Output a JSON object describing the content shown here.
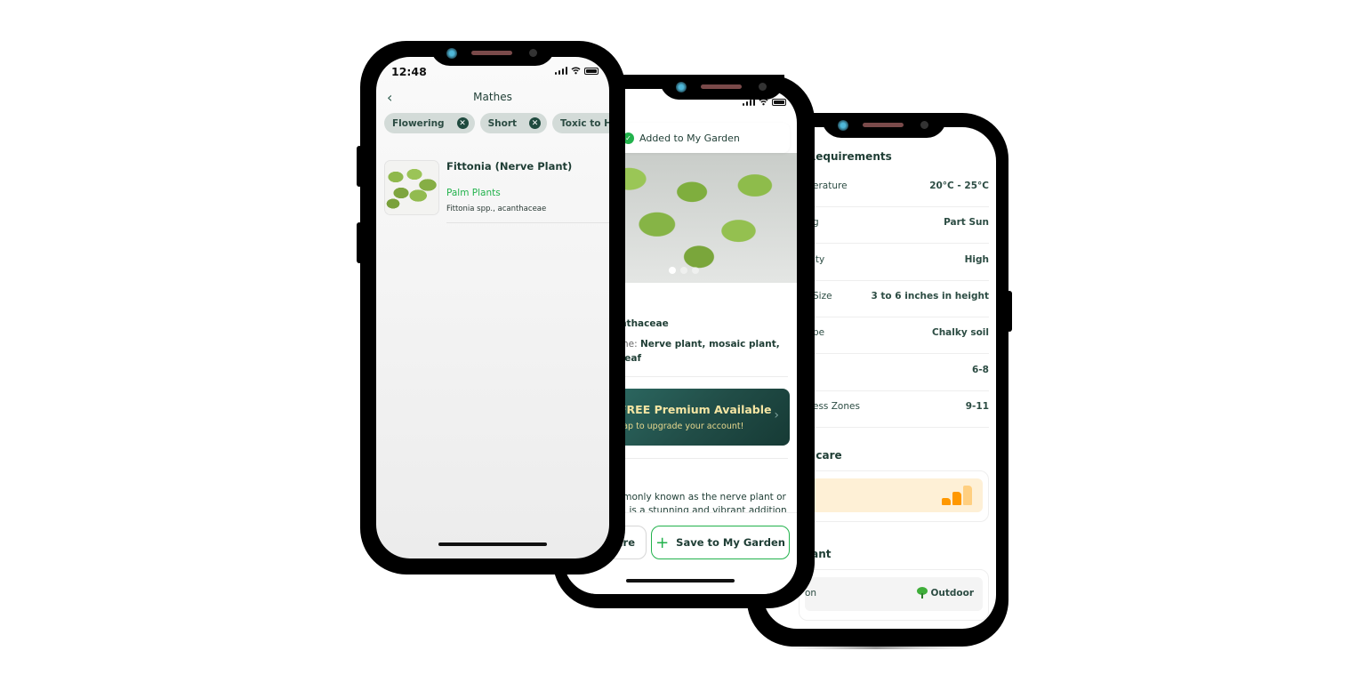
{
  "phone1": {
    "status_time": "12:48",
    "nav": {
      "back_icon": "chevron-left",
      "title": "Mathes"
    },
    "filter_chips": [
      {
        "label": "Flowering",
        "remove_icon": "close-circle"
      },
      {
        "label": "Short",
        "remove_icon": "close-circle"
      },
      {
        "label": "Toxic to Human",
        "remove_icon": "close-circle"
      }
    ],
    "results": [
      {
        "name": "Fittonia (Nerve Plant)",
        "category": "Palm Plants",
        "scientific": "Fittonia spp., acanthaceae",
        "image": "fittonia-thumbnail"
      }
    ]
  },
  "phone2": {
    "toast": {
      "icon": "check-circle",
      "text": "Added to My Garden"
    },
    "carousel": {
      "image": "fittonia-photo",
      "pages": 3,
      "current": 1
    },
    "title_visible": "a",
    "family_visible": "anthaceae",
    "common_name_label_visible": "ame:",
    "common_name_value_visible": "Nerve plant, mosaic plant,",
    "common_name_value_line2_visible": "t leaf",
    "premium": {
      "title": "FREE Premium Available",
      "subtitle": "Tap to upgrade your account!",
      "chevron_icon": "chevron-right"
    },
    "about_visible": "mmonly known as the nerve plant or nt, is a stunning and vibrant addition",
    "buttons": {
      "share_visible": "are",
      "save": "Save to My Garden",
      "save_icon": "plus"
    }
  },
  "phone3": {
    "requirements_title_visible": "Requirements",
    "requirements": [
      {
        "key_visible": "erature",
        "value": "20°C - 25°C"
      },
      {
        "key_visible": "g",
        "value": "Part Sun"
      },
      {
        "key_visible": "ity",
        "value": "High"
      },
      {
        "key_visible": "Size",
        "value": "3 to 6 inches in height"
      },
      {
        "key_visible": "pe",
        "value": "Chalky soil"
      },
      {
        "key_visible": "",
        "value": "6-8"
      },
      {
        "key_visible": "ess Zones",
        "value": "9-11"
      }
    ],
    "care_title_visible": "f care",
    "care_level": {
      "filled": 2,
      "total": 3
    },
    "placement_title_visible": "lant",
    "placement": {
      "key_visible": "on",
      "value": "Outdoor",
      "icon": "tree"
    }
  },
  "colors": {
    "brand_green": "#22b24c",
    "dark_text": "#1e3d34",
    "chip_bg": "#d3dbd8",
    "premium_gold": "#f4e5a3",
    "care_orange": "#ff9800",
    "care_bg": "#fef0d6"
  }
}
